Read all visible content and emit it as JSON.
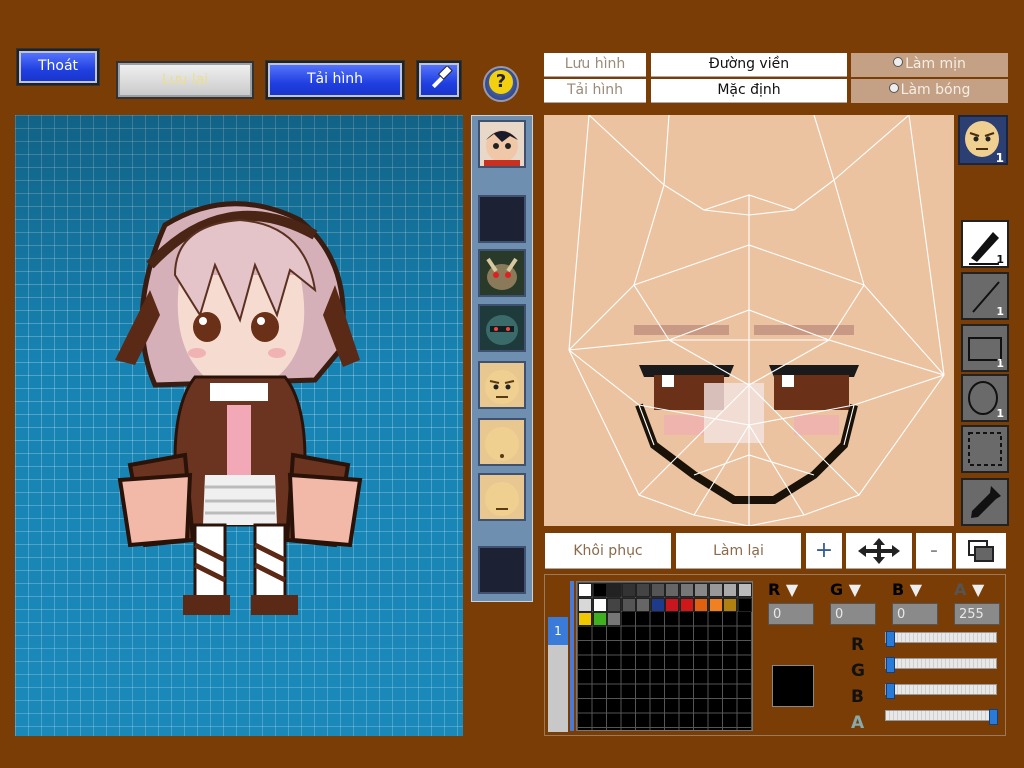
{
  "top_bar": {
    "exit_label": "Thoát",
    "save_label": "Lưu lại",
    "load_label": "Tải hình",
    "help_symbol": "?"
  },
  "texture_toolbar": {
    "save_image_label": "Lưu hình",
    "load_image_label": "Tải hình",
    "outline_label": "Đường viền",
    "default_label": "Mặc định",
    "smooth_label": "Làm mịn",
    "shade_label": "Làm bóng"
  },
  "face_thumb_badge": "1",
  "tools": [
    {
      "name": "pen-tool",
      "icon": "pen-icon",
      "count": "1"
    },
    {
      "name": "line-tool",
      "icon": "line-icon",
      "count": "1"
    },
    {
      "name": "rect-tool",
      "icon": "rectangle-icon",
      "count": "1"
    },
    {
      "name": "ellipse-tool",
      "icon": "ellipse-icon",
      "count": "1"
    },
    {
      "name": "select-tool",
      "icon": "dashed-select-icon",
      "count": ""
    },
    {
      "name": "eyedropper-tool",
      "icon": "eyedropper-icon",
      "count": ""
    }
  ],
  "actions": {
    "restore_label": "Khôi phục",
    "redo_label": "Làm lại",
    "zoom_in_symbol": "+",
    "zoom_out_symbol": "-"
  },
  "palette_tab": "1",
  "palette_colors": [
    "#ffffff",
    "#000000",
    "#222222",
    "#333333",
    "#444444",
    "#555555",
    "#666666",
    "#777777",
    "#888888",
    "#999999",
    "#aaaaaa",
    "#bbbbbb",
    "#d8d8d8",
    "#ffffff",
    "#444444",
    "#555555",
    "#666666",
    "#1e3a8a",
    "#c8161e",
    "#d01818",
    "#e06010",
    "#f08020",
    "#b08010",
    "#000000",
    "#f0c800",
    "#40b020",
    "#777777"
  ],
  "channels": {
    "r": {
      "label": "R",
      "value": "0"
    },
    "g": {
      "label": "G",
      "value": "0"
    },
    "b": {
      "label": "B",
      "value": "0"
    },
    "a": {
      "label": "A",
      "value": "255"
    }
  },
  "current_color": "#000000",
  "sliders": {
    "r": 0,
    "g": 0,
    "b": 0,
    "a": 255
  },
  "colors": {
    "background": "#7a3d05",
    "grid_blue": "#1783b3",
    "skin": "#ecc3a0",
    "button_blue": "#1f3fe0"
  }
}
